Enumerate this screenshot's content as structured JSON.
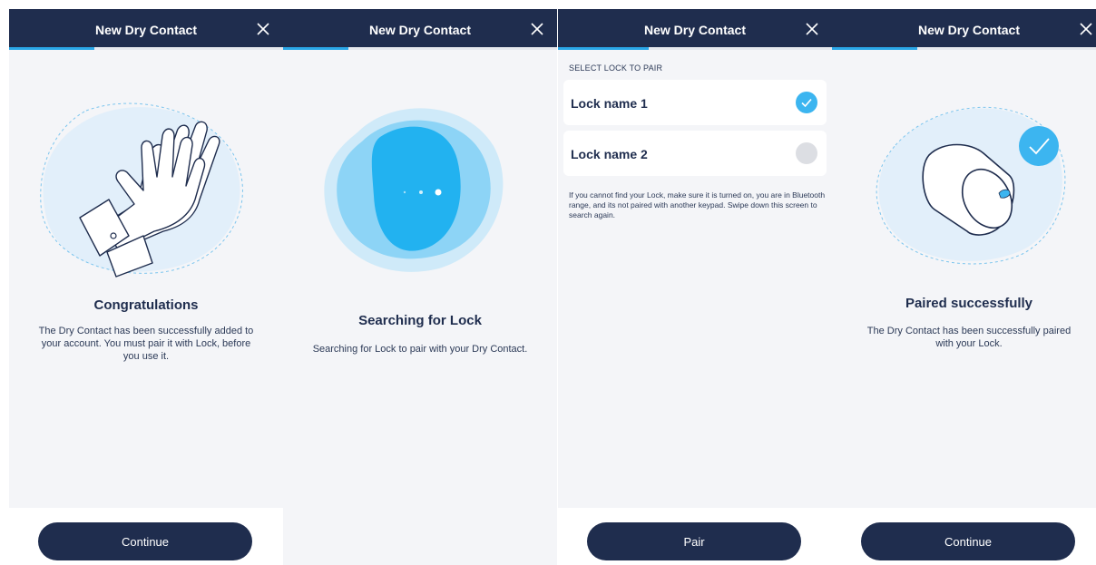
{
  "screens": [
    {
      "header_title": "New Dry Contact",
      "progress": 0.31,
      "illustration": "clapping-hands",
      "title": "Congratulations",
      "body": "The Dry Contact has been successfully added to your account. You must pair it with Lock, before you use it.",
      "button_label": "Continue"
    },
    {
      "header_title": "New Dry Contact",
      "progress": 0.24,
      "illustration": "searching-blob",
      "title": "Searching for Lock",
      "body": "Searching for Lock to pair with your Dry Contact."
    },
    {
      "header_title": "New Dry Contact",
      "progress": 0.33,
      "section_label": "SELECT LOCK TO PAIR",
      "locks": [
        {
          "name": "Lock name 1",
          "selected": true
        },
        {
          "name": "Lock name 2",
          "selected": false
        }
      ],
      "hint": "If you cannot find your Lock, make sure it is turned on, you are in Bluetooth range, and its not paired with another keypad. Swipe down this screen to search again.",
      "button_label": "Pair"
    },
    {
      "header_title": "New Dry Contact",
      "progress": 0.31,
      "illustration": "lock-paired",
      "title": "Paired successfully",
      "body": "The Dry Contact has been successfully paired with your Lock.",
      "button_label": "Continue"
    }
  ],
  "colors": {
    "header": "#1f2d4e",
    "accent": "#2aa7e8",
    "screen_bg": "#f4f5f8",
    "check": "#3cb5f0"
  }
}
